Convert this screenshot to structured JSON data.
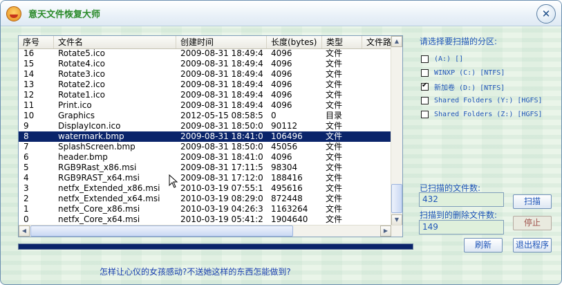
{
  "window": {
    "title": "意天文件恢复大师",
    "close_glyph": "✕"
  },
  "table": {
    "headers": [
      "序号",
      "文件名",
      "创建时间",
      "长度(bytes)",
      "类型",
      "文件路径"
    ],
    "rows": [
      {
        "no": "16",
        "name": "Rotate5.ico",
        "time": "2009-08-31 18:49:40",
        "size": "4096",
        "type": "文件"
      },
      {
        "no": "15",
        "name": "Rotate4.ico",
        "time": "2009-08-31 18:49:40",
        "size": "4096",
        "type": "文件"
      },
      {
        "no": "14",
        "name": "Rotate3.ico",
        "time": "2009-08-31 18:49:40",
        "size": "4096",
        "type": "文件"
      },
      {
        "no": "13",
        "name": "Rotate2.ico",
        "time": "2009-08-31 18:49:40",
        "size": "4096",
        "type": "文件"
      },
      {
        "no": "12",
        "name": "Rotate1.ico",
        "time": "2009-08-31 18:49:40",
        "size": "4096",
        "type": "文件"
      },
      {
        "no": "11",
        "name": "Print.ico",
        "time": "2009-08-31 18:49:40",
        "size": "4096",
        "type": "文件"
      },
      {
        "no": "10",
        "name": "Graphics",
        "time": "2012-05-15 08:58:53",
        "size": "0",
        "type": "目录"
      },
      {
        "no": "9",
        "name": "DisplayIcon.ico",
        "time": "2009-08-31 18:50:08",
        "size": "90112",
        "type": "文件"
      },
      {
        "no": "8",
        "name": "watermark.bmp",
        "time": "2009-08-31 18:41:00",
        "size": "106496",
        "type": "文件"
      },
      {
        "no": "7",
        "name": "SplashScreen.bmp",
        "time": "2009-08-31 18:50:08",
        "size": "45056",
        "type": "文件"
      },
      {
        "no": "6",
        "name": "header.bmp",
        "time": "2009-08-31 18:41:00",
        "size": "4096",
        "type": "文件"
      },
      {
        "no": "5",
        "name": "RGB9Rast_x86.msi",
        "time": "2009-08-31 17:11:58",
        "size": "98304",
        "type": "文件"
      },
      {
        "no": "4",
        "name": "RGB9RAST_x64.msi",
        "time": "2009-08-31 17:12:02",
        "size": "188416",
        "type": "文件"
      },
      {
        "no": "3",
        "name": "netfx_Extended_x86.msi",
        "time": "2010-03-19 07:55:18",
        "size": "495616",
        "type": "文件"
      },
      {
        "no": "2",
        "name": "netfx_Extended_x64.msi",
        "time": "2010-03-19 08:29:04",
        "size": "872448",
        "type": "文件"
      },
      {
        "no": "1",
        "name": "netfx_Core_x86.msi",
        "time": "2010-03-19 04:26:32",
        "size": "1163264",
        "type": "文件"
      },
      {
        "no": "0",
        "name": "netfx_Core_x64.msi",
        "time": "2010-03-19 05:41:24",
        "size": "1904640",
        "type": "文件"
      }
    ],
    "selected_row_no": "8"
  },
  "progress": {
    "value_fraction": 1.0
  },
  "link_text": "怎样让心仪的女孩感动?不送她这样的东西怎能做到?",
  "partitions": {
    "label": "请选择要扫描的分区:",
    "items": [
      {
        "label": "(A:) []",
        "checked": false
      },
      {
        "label": "WINXP (C:) [NTFS]",
        "checked": false
      },
      {
        "label": "新加卷 (D:) [NTFS]",
        "checked": true
      },
      {
        "label": "Shared Folders (Y:) [HGFS]",
        "checked": false
      },
      {
        "label": "Shared Folders (Z:) [HGFS]",
        "checked": false
      }
    ]
  },
  "scanned": {
    "label": "已扫描的文件数:",
    "value": "432"
  },
  "deleted": {
    "label": "扫描到的删除文件数:",
    "value": "149"
  },
  "buttons": {
    "scan": "扫描",
    "stop": "停止",
    "refresh": "刷新",
    "exit": "退出程序"
  },
  "colors": {
    "selection": "#0a246a",
    "label_blue": "#1f55b8",
    "title_green": "#2a8a2a"
  }
}
